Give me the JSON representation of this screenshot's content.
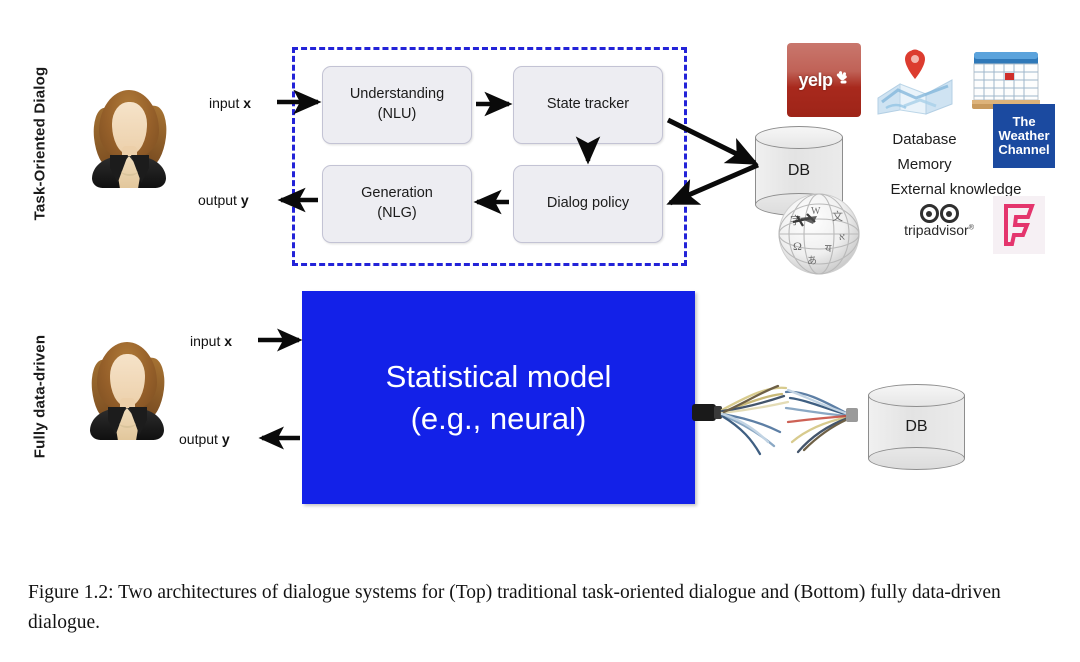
{
  "figure": {
    "rows": [
      {
        "label": "Task-Oriented Dialog"
      },
      {
        "label": "Fully data-driven"
      }
    ],
    "top_pipeline": {
      "io": {
        "input": "input ",
        "input_var": "x",
        "output": "output ",
        "output_var": "y"
      },
      "boxes": [
        {
          "name": "understanding",
          "line1": "Understanding",
          "line2": "(NLU)"
        },
        {
          "name": "state-tracker",
          "line1": "State tracker",
          "line2": ""
        },
        {
          "name": "dialog-policy",
          "line1": "Dialog policy",
          "line2": ""
        },
        {
          "name": "generation",
          "line1": "Generation",
          "line2": "(NLG)"
        }
      ],
      "db_label": "DB",
      "knowledge_lines": [
        "Database",
        "Memory",
        "External knowledge"
      ],
      "logos": [
        {
          "name": "yelp-logo",
          "text": "yelp"
        },
        {
          "name": "maps-logo",
          "text": ""
        },
        {
          "name": "calendar-logo",
          "text": ""
        },
        {
          "name": "weather-channel-logo",
          "l1": "The",
          "l2": "Weather",
          "l3": "Channel"
        },
        {
          "name": "wikipedia-logo",
          "text": ""
        },
        {
          "name": "tripadvisor-logo",
          "text": "tripadvisor",
          "sup": "®"
        },
        {
          "name": "foursquare-logo",
          "text": ""
        }
      ]
    },
    "bottom_pipeline": {
      "io": {
        "input": "input ",
        "input_var": "x",
        "output": "output ",
        "output_var": "y"
      },
      "model": {
        "line1": "Statistical model",
        "line2": "(e.g., neural)"
      },
      "db_label": "DB"
    },
    "colors": {
      "dashed_border": "#2323d8",
      "model_fill": "#1321e8",
      "box_fill": "#ededf2",
      "yelp_red": "#a8291d",
      "weather_blue": "#1b4aa0",
      "foursquare_pink": "#e4356d"
    }
  },
  "caption": {
    "text": "Figure 1.2: Two architectures of dialogue systems for (Top) traditional task-oriented dialogue and (Bottom) fully data-driven dialogue."
  }
}
